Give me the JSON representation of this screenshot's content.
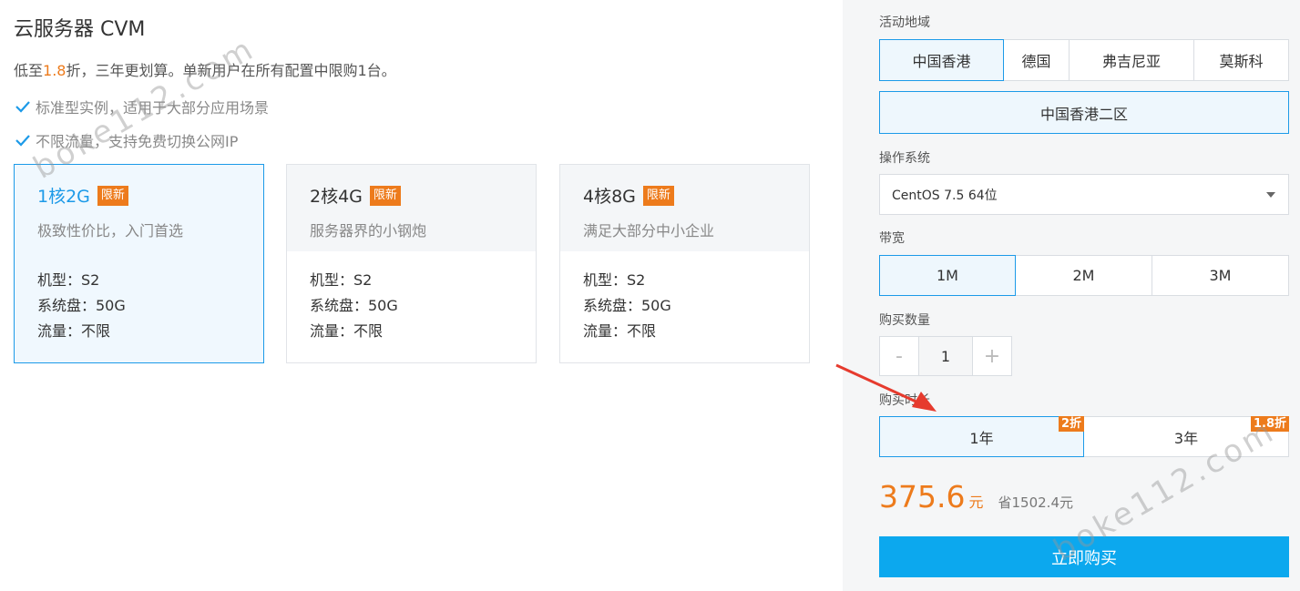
{
  "header": {
    "title": "云服务器 CVM",
    "subtitle_prefix": "低至",
    "subtitle_highlight": "1.8",
    "subtitle_suffix": "折，三年更划算。单新用户在所有配置中限购1台。"
  },
  "features": [
    "标准型实例，适用于大部分应用场景",
    "不限流量，支持免费切换公网IP"
  ],
  "plans": [
    {
      "name": "1核2G",
      "badge": "限新",
      "desc": "极致性价比，入门首选",
      "model": "机型：S2",
      "disk": "系统盘：50G",
      "traffic": "流量：不限",
      "selected": true
    },
    {
      "name": "2核4G",
      "badge": "限新",
      "desc": "服务器界的小钢炮",
      "model": "机型：S2",
      "disk": "系统盘：50G",
      "traffic": "流量：不限",
      "selected": false
    },
    {
      "name": "4核8G",
      "badge": "限新",
      "desc": "满足大部分中小企业",
      "model": "机型：S2",
      "disk": "系统盘：50G",
      "traffic": "流量：不限",
      "selected": false
    }
  ],
  "order": {
    "region_label": "活动地域",
    "regions": [
      "中国香港",
      "德国",
      "弗吉尼亚",
      "莫斯科"
    ],
    "selected_region": "中国香港",
    "zone": "中国香港二区",
    "os_label": "操作系统",
    "os_value": "CentOS 7.5 64位",
    "bandwidth_label": "带宽",
    "bandwidths": [
      "1M",
      "2M",
      "3M"
    ],
    "selected_bandwidth": "1M",
    "quantity_label": "购买数量",
    "quantity_minus": "-",
    "quantity_value": "1",
    "quantity_plus": "+",
    "duration_label": "购买时长",
    "durations": [
      {
        "label": "1年",
        "discount": "2折"
      },
      {
        "label": "3年",
        "discount": "1.8折"
      }
    ],
    "selected_duration": "1年",
    "price": "375.6",
    "price_unit": "元",
    "saving": "省1502.4元",
    "buy_label": "立即购买"
  },
  "watermark": "boke112.com",
  "colors": {
    "accent": "#1c9ae8",
    "orange": "#ed7b1c",
    "buy": "#0ca8ee",
    "arrow": "#e63b2e"
  }
}
